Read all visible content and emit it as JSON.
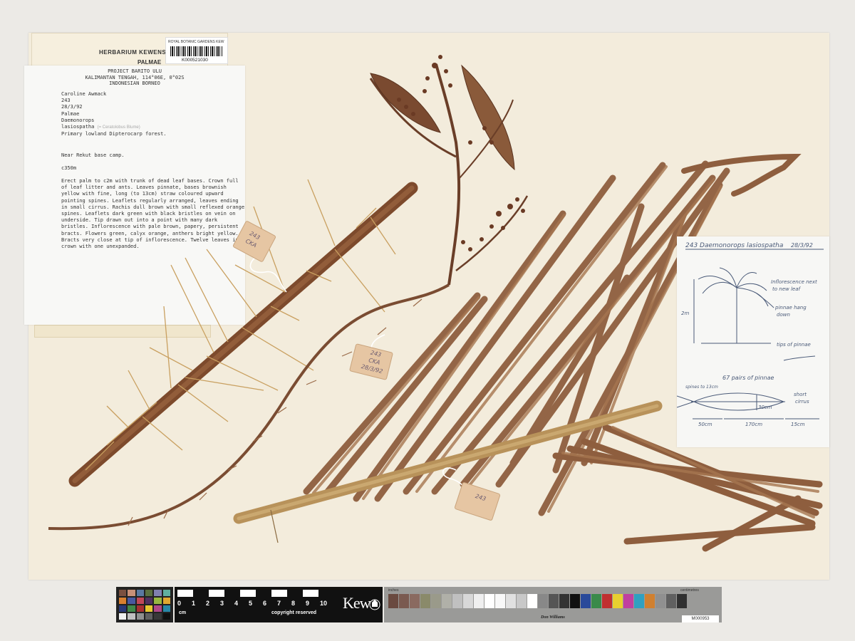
{
  "header_label": {
    "institution": "HERBARIUM KEWENSE",
    "family": "PALMAE",
    "barcode_org": "ROYAL BOTANIC GARDENS KEW",
    "barcode_id": "K000521030"
  },
  "collector_label": {
    "project": [
      "PROJECT BARITO ULU",
      "KALIMANTAN TENGAH, 114°06E, 0°02S",
      "INDONESIAN BORNEO"
    ],
    "collector": "Caroline Awmack",
    "number": "243",
    "date": "28/3/92",
    "family": "Palmae",
    "genus": "Daemonorops",
    "species": "lasiospatha",
    "pencil_note": "(= Ceratolobus Blume)",
    "habitat": "Primary lowland Dipterocarp forest.",
    "locality": "Near Rekut base camp.",
    "altitude": "c350m",
    "description": "Erect palm to c2m with trunk of dead leaf bases. Crown full of leaf litter and ants. Leaves pinnate, bases brownish yellow with fine, long (to 13cm) straw coloured upward pointing spines. Leaflets regularly arranged, leaves ending in small cirrus. Rachis dull brown with small reflexed orange spines. Leaflets dark green with black bristles on vein on underside. Tip drawn out into a point with many dark bristles. Inflorescence with pale brown, papery, persistent bracts. Flowers green, calyx orange, anthers bright yellow. Bracts very close at tip of inflorescence. Twelve leaves in crown with one unexpanded."
  },
  "sketch_note": {
    "title": "243 Daemonorops lasiospatha",
    "date": "28/3/92",
    "notes": [
      "Inflorescence next",
      "to new leaf",
      "pinnae hang",
      "down",
      "tips of pinnae",
      "67 pairs of pinnae",
      "spines to 13cm",
      "short",
      "cirrus"
    ],
    "height": "2m",
    "width": "30cm",
    "lengths": [
      "50cm",
      "170cm",
      "15cm"
    ]
  },
  "tags": {
    "tag1": [
      "243",
      "CKA"
    ],
    "tag2": [
      "243",
      "CKA",
      "28/3/92"
    ],
    "tag3": [
      "243"
    ]
  },
  "scale_bar": {
    "ticks": [
      "0",
      "1",
      "2",
      "3",
      "4",
      "5",
      "6",
      "7",
      "8",
      "9",
      "10"
    ],
    "unit": "cm",
    "copyright": "copyright reserved",
    "brand": "Kew",
    "chart_top_left": "inches",
    "chart_top_right": "centimetres",
    "chart_brand": "Don Williams",
    "chart_code": "M000953"
  },
  "colors": {
    "sheet": "#f3ecdc",
    "rachis": "#8a5a3c",
    "leaf": "#9a6a48",
    "spine": "#c9a060",
    "tag": "#e6c6a3",
    "handwriting": "#4a5a78"
  }
}
